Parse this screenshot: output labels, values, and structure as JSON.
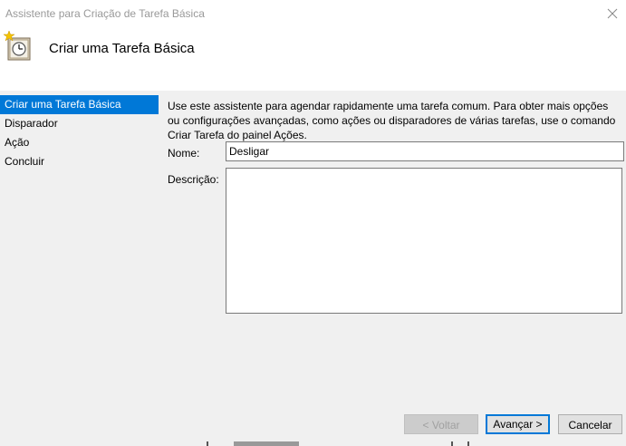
{
  "window": {
    "title": "Assistente para Criação de Tarefa Básica",
    "heading": "Criar uma Tarefa Básica",
    "close_icon": "close-icon"
  },
  "sidebar": {
    "items": [
      {
        "label": "Criar uma Tarefa Básica",
        "active": true
      },
      {
        "label": "Disparador",
        "active": false
      },
      {
        "label": "Ação",
        "active": false
      },
      {
        "label": "Concluir",
        "active": false
      }
    ]
  },
  "main": {
    "description": "Use este assistente para agendar rapidamente uma tarefa comum. Para obter mais opções ou configurações avançadas, como ações ou disparadores de várias tarefas, use o comando Criar Tarefa do painel Ações.",
    "name_label": "Nome:",
    "name_value": "Desligar",
    "description_label": "Descrição:",
    "description_value": ""
  },
  "buttons": {
    "back": "< Voltar",
    "next": "Avançar >",
    "cancel": "Cancelar"
  },
  "colors": {
    "accent": "#0078d7",
    "title_text": "#999999"
  }
}
